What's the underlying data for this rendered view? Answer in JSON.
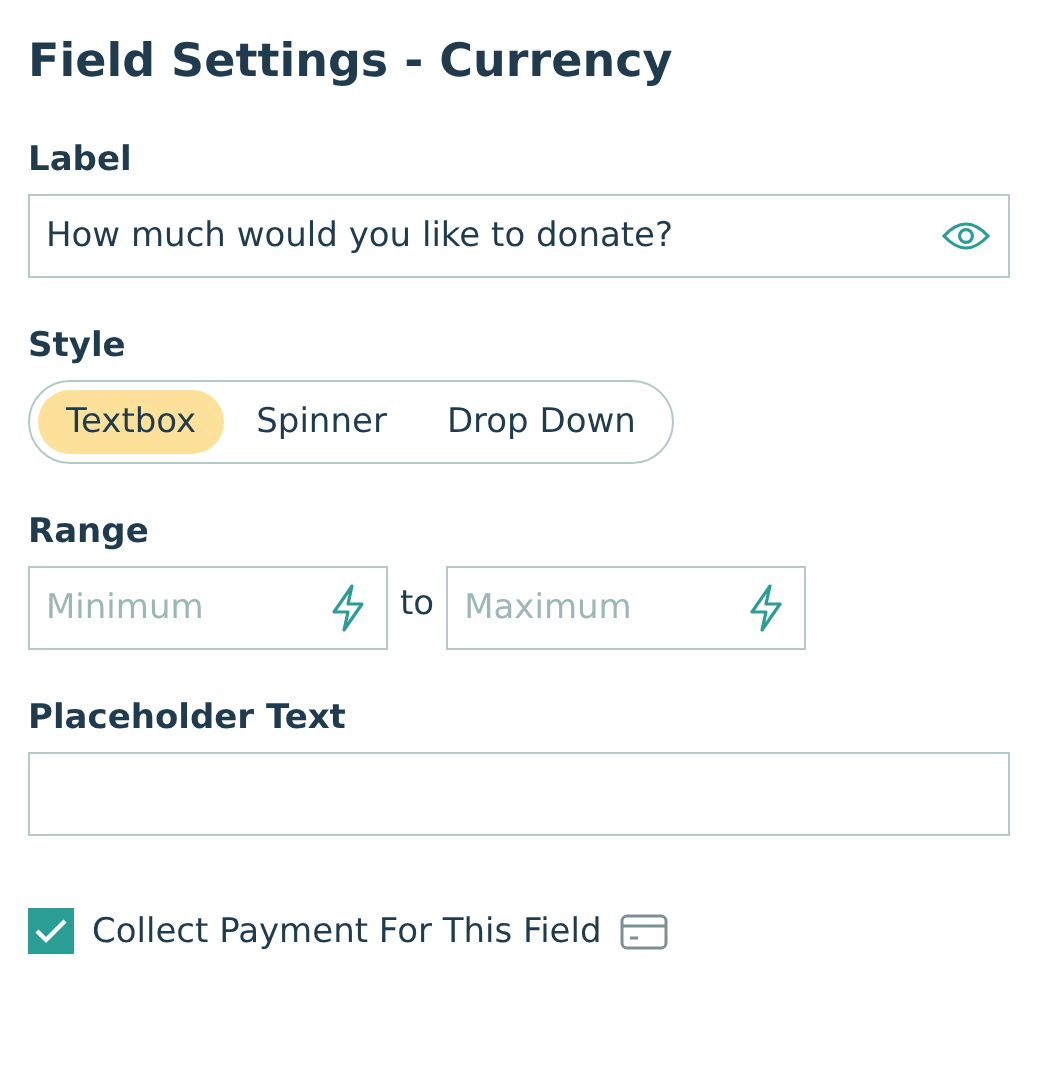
{
  "title": "Field Settings - Currency",
  "label": {
    "heading": "Label",
    "value": "How much would you like to donate?"
  },
  "style": {
    "heading": "Style",
    "options": [
      {
        "label": "Textbox",
        "selected": true
      },
      {
        "label": "Spinner",
        "selected": false
      },
      {
        "label": "Drop Down",
        "selected": false
      }
    ]
  },
  "range": {
    "heading": "Range",
    "minimum": {
      "placeholder": "Minimum"
    },
    "separator": "to",
    "maximum": {
      "placeholder": "Maximum"
    }
  },
  "placeholder_text": {
    "heading": "Placeholder Text"
  },
  "collect_payment": {
    "label": "Collect Payment For This Field",
    "checked": true
  }
}
